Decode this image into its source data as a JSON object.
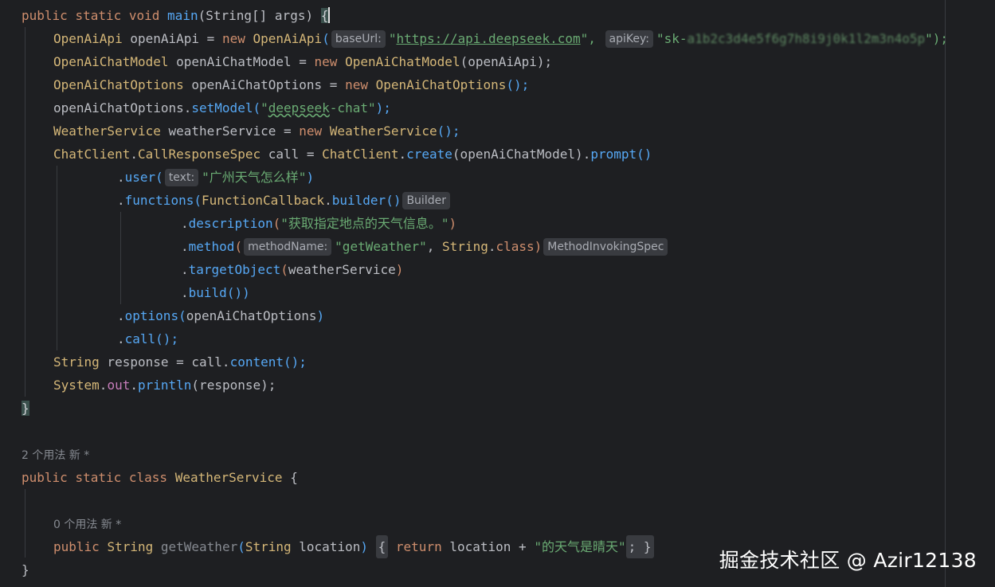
{
  "code": {
    "l1": {
      "pub": "public",
      "static": "static",
      "void": "void",
      "main": "main",
      "op": "(",
      "type": "String[]",
      "sp": " ",
      "args": "args",
      "cp": ")",
      "brace": "{"
    },
    "l2": {
      "type": "OpenAiApi",
      "var": " openAiApi = ",
      "new": "new",
      "cls": "OpenAiApi",
      "op": "(",
      "hint1": "baseUrl:",
      "url": "https://api.deepseek.com",
      "comma": "\", ",
      "hint2": "apiKey:",
      "key_prefix": "\"sk-",
      "key_masked": "a1b2c3d4e5f6g7h8i9j0k1l2m3n4o5p",
      "end": "\");"
    },
    "l3": {
      "type": "OpenAiChatModel",
      "var": " openAiChatModel = ",
      "new": "new",
      "cls": "OpenAiChatModel",
      "arg": "(openAiApi);"
    },
    "l4": {
      "type": "OpenAiChatOptions",
      "var": " openAiChatOptions = ",
      "new": "new",
      "cls": "OpenAiChatOptions",
      "arg": "();"
    },
    "l5": {
      "obj": "openAiChatOptions.",
      "fn": "setModel",
      "op": "(",
      "str_a": "\"",
      "str_b": "deepseek",
      "str_c": "-chat\"",
      "end": ");"
    },
    "l6": {
      "type": "WeatherService",
      "var": " weatherService = ",
      "new": "new",
      "cls": "WeatherService",
      "arg": "();"
    },
    "l7": {
      "type": "ChatClient",
      "dot": ".",
      "type2": "CallResponseSpec",
      "var": " call = ",
      "cls": "ChatClient",
      "dot2": ".",
      "fn": "create",
      "arg": "(openAiChatModel)",
      "dot3": ".",
      "fn2": "prompt",
      "end": "()"
    },
    "l8": {
      "dot": ".",
      "fn": "user",
      "op": "(",
      "hint": "text:",
      "str": "\"广州天气怎么样\"",
      "end": ")"
    },
    "l9": {
      "dot": ".",
      "fn": "functions",
      "op": "(",
      "cls": "FunctionCallback",
      "dot2": ".",
      "fn2": "builder",
      "end": "()",
      "hint": "Builder"
    },
    "l10": {
      "dot": ".",
      "fn": "description",
      "op": "(",
      "str": "\"获取指定地点的天气信息。\"",
      "end": ")"
    },
    "l11": {
      "dot": ".",
      "fn": "method",
      "op": "(",
      "hint": "methodName:",
      "str": "\"getWeather\"",
      "mid": ", ",
      "cls": "String",
      "dot2": ".",
      "kw": "class",
      "end": ")",
      "hint2": "MethodInvokingSpec"
    },
    "l12": {
      "dot": ".",
      "fn": "targetObject",
      "op": "(",
      "arg": "weatherService",
      "end": ")"
    },
    "l13": {
      "dot": ".",
      "fn": "build",
      "end": "())"
    },
    "l14": {
      "dot": ".",
      "fn": "options",
      "op": "(",
      "arg": "openAiChatOptions",
      "end": ")"
    },
    "l15": {
      "dot": ".",
      "fn": "call",
      "end": "();"
    },
    "l16": {
      "type": "String",
      "var": " response = call.",
      "fn": "content",
      "end": "();"
    },
    "l17": {
      "type": "System",
      "dot": ".",
      "field": "out",
      "dot2": ".",
      "fn": "println",
      "arg": "(response);"
    },
    "l18": {
      "brace": "}"
    },
    "usage1": "2 个用法   新 *",
    "l20": {
      "pub": "public",
      "static": "static",
      "class": "class",
      "cls": "WeatherService",
      "brace": "{"
    },
    "usage2": "0 个用法   新 *",
    "l22": {
      "pub": "public",
      "type": "String",
      "fn": "getWeather",
      "op": "(",
      "ptype": "String",
      "param": "location",
      "cp": ")",
      "ob": "{",
      "ret": "return",
      "var": "location",
      "plus": " + ",
      "str": "\"的天气是晴天\"",
      "semi": ";",
      "cb": "}"
    },
    "l23": {
      "brace": "}"
    }
  },
  "watermark": "掘金技术社区 @ Azir12138"
}
